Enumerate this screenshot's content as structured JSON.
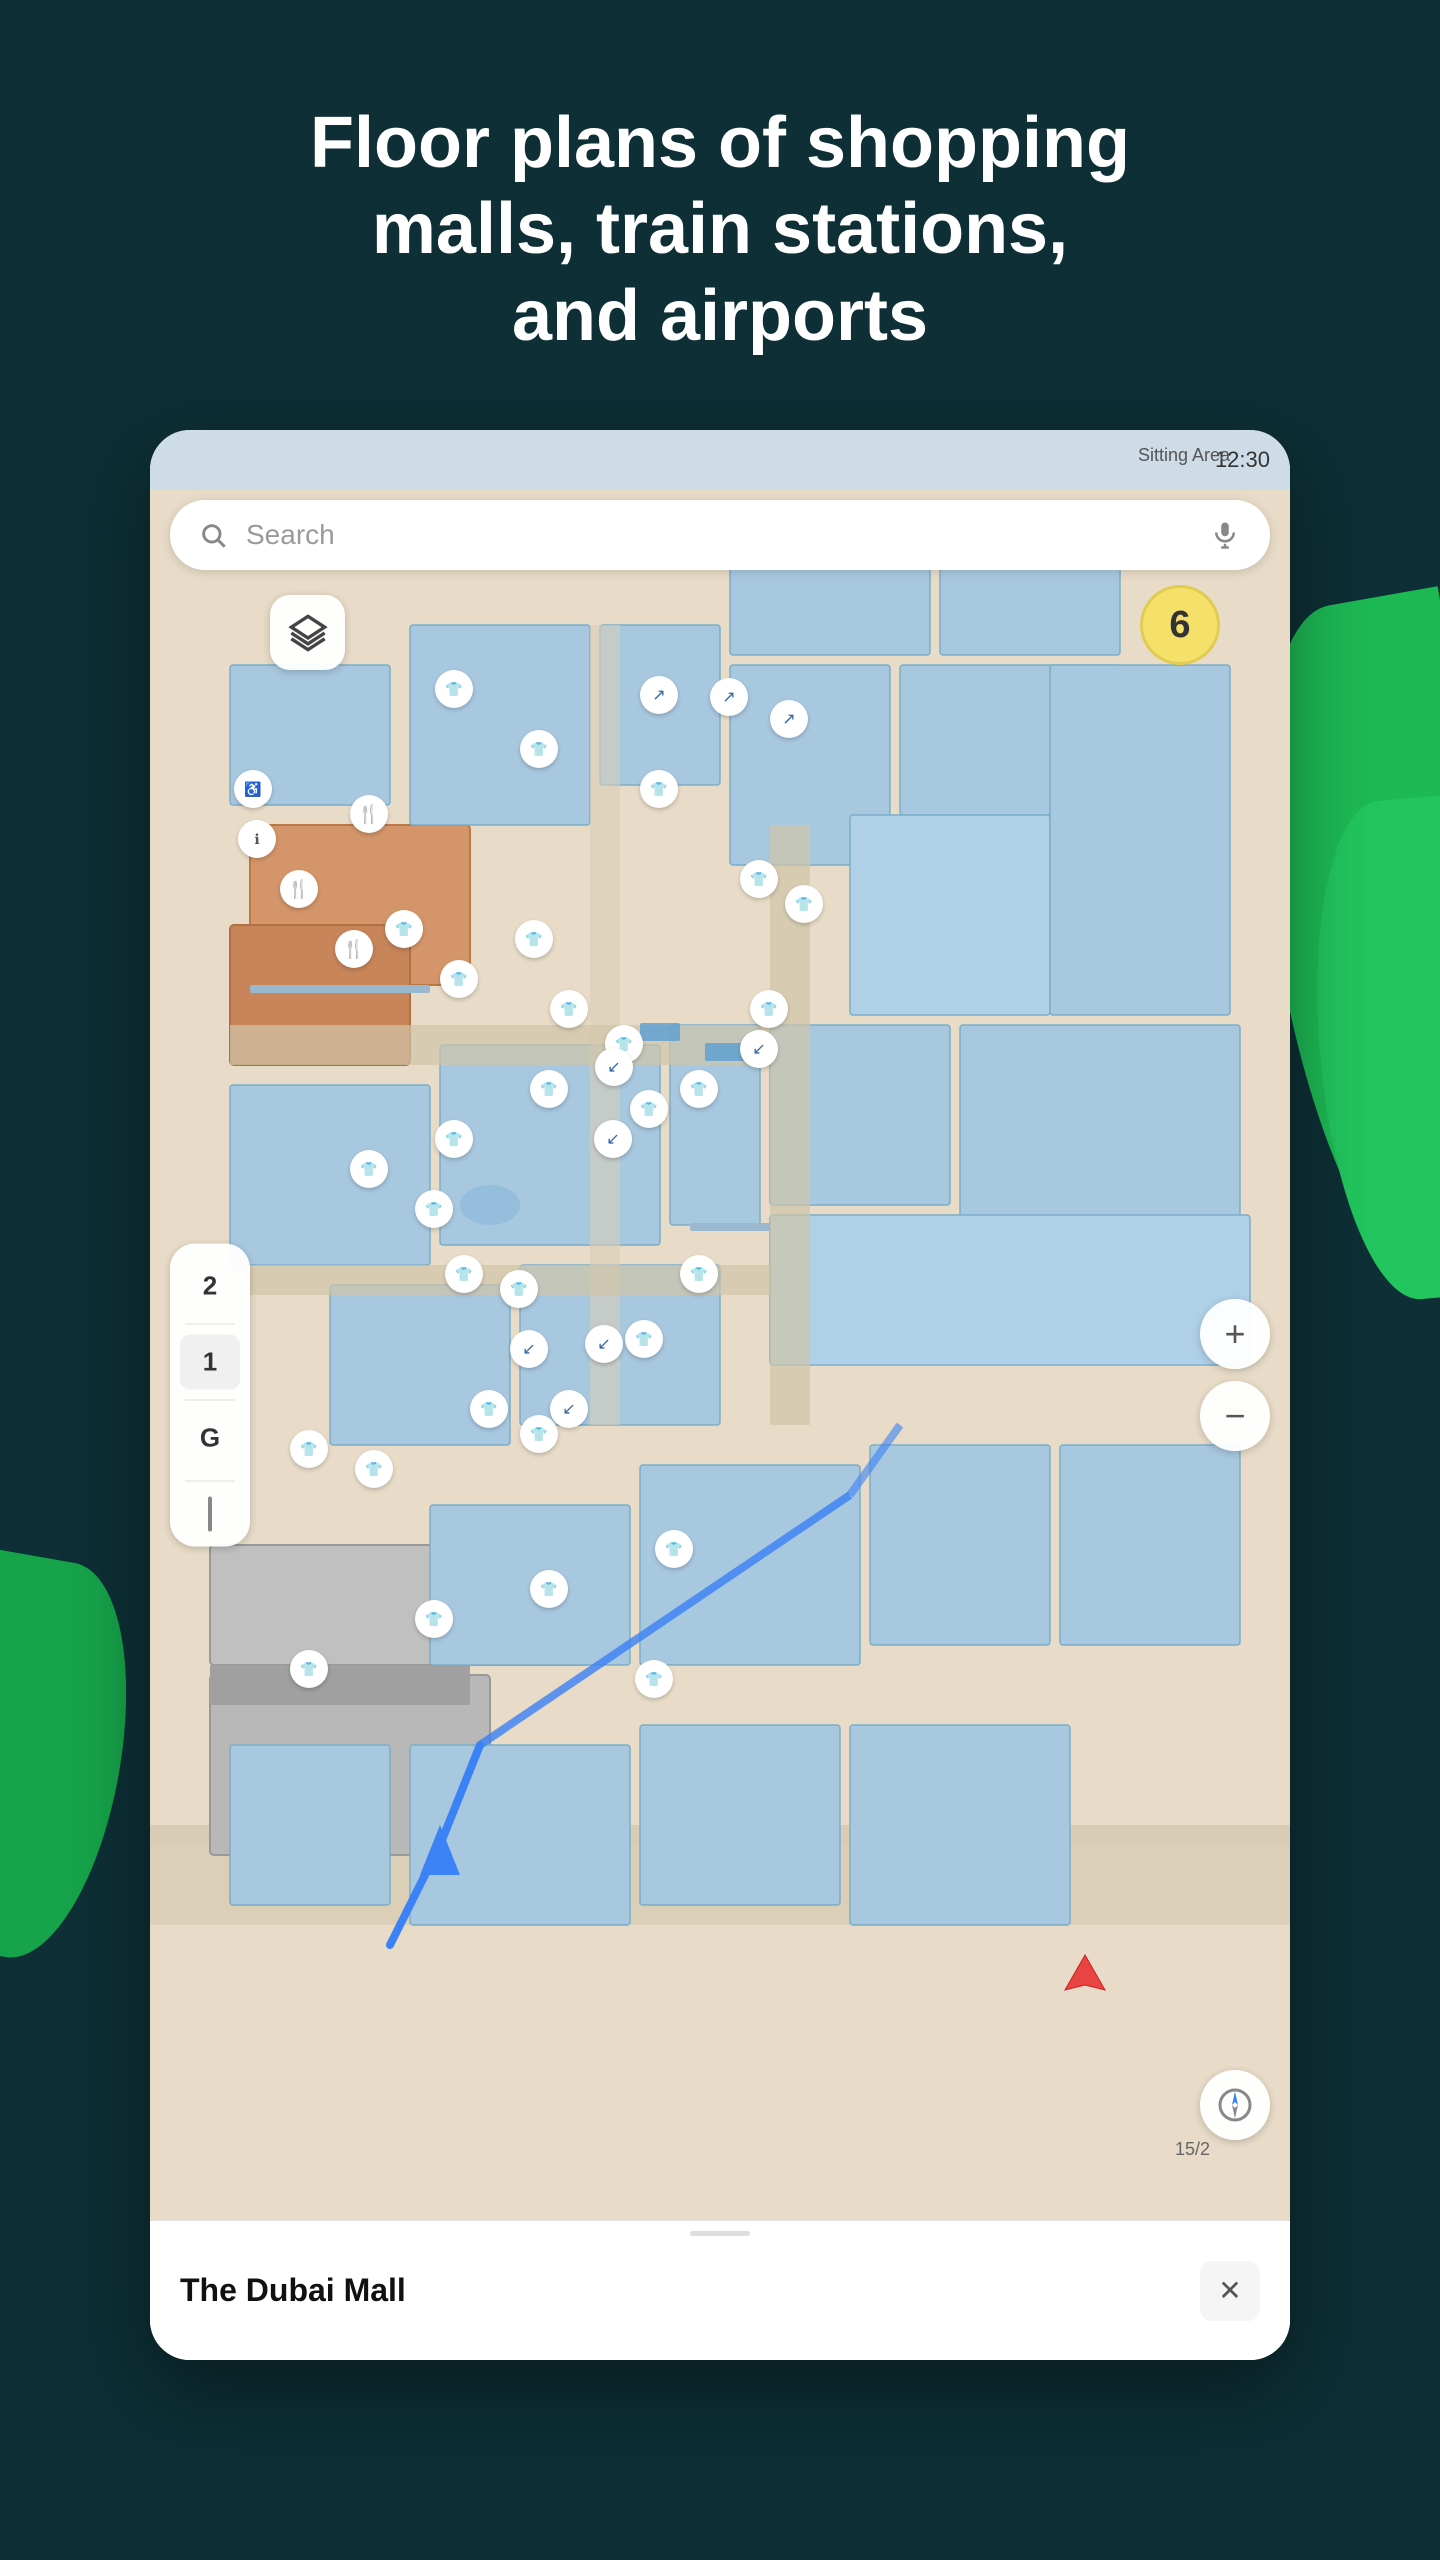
{
  "header": {
    "title_line1": "Floor plans of shopping",
    "title_line2": "malls, train stations,",
    "title_line3": "and airports"
  },
  "status_bar": {
    "time": "12:30",
    "area_label": "Sitting Area"
  },
  "search": {
    "placeholder": "Search",
    "search_icon": "🔍",
    "mic_icon": "🎙"
  },
  "floor_selector": {
    "floors": [
      "2",
      "1",
      "G"
    ],
    "active_floor": "1"
  },
  "zoom": {
    "plus_label": "+",
    "minus_label": "−"
  },
  "floor_badge": {
    "number": "6"
  },
  "map": {
    "road_label": "15/2",
    "navigation_arrow": "↑"
  },
  "bottom_bar": {
    "place_name": "The Dubai Mall",
    "close_icon": "✕"
  },
  "icons": {
    "layer": "⊞",
    "coat_hanger": "👔",
    "food": "🍴",
    "escalator_up": "↗",
    "escalator_down": "↙",
    "info": "ℹ",
    "accessibility": "♿",
    "location_arrow": "➤"
  }
}
